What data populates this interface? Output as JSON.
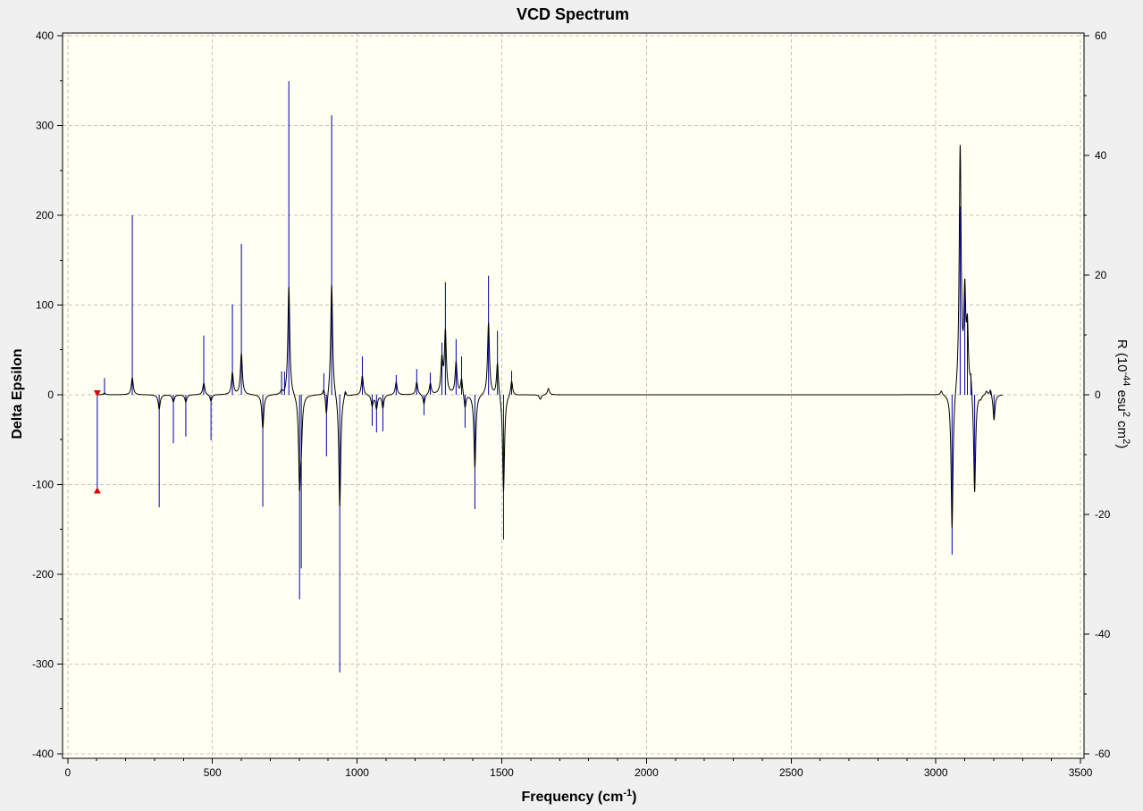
{
  "chart_data": {
    "type": "line",
    "title": "VCD Spectrum",
    "xlabel": [
      {
        "text": "Frequency (cm"
      },
      {
        "text": "-1",
        "sup": true
      },
      {
        "text": ")"
      }
    ],
    "ylabel": "Delta Epsilon",
    "ylabel_right": [
      {
        "text": "R (10"
      },
      {
        "text": "-44",
        "sup": true
      },
      {
        "text": " esu"
      },
      {
        "text": "2",
        "sup": true
      },
      {
        "text": " cm"
      },
      {
        "text": "2",
        "sup": true
      },
      {
        "text": ")"
      }
    ],
    "xlim": [
      -18,
      3512
    ],
    "ylim": [
      -405,
      403
    ],
    "ylim_right": [
      -60.75,
      60.45
    ],
    "x_ticks": [
      0,
      500,
      1000,
      1500,
      2000,
      2500,
      3000,
      3500
    ],
    "y_ticks": [
      -400,
      -300,
      -200,
      -100,
      0,
      100,
      200,
      300,
      400
    ],
    "y_right_ticks": [
      -60,
      -40,
      -20,
      0,
      20,
      40,
      60
    ],
    "grid": true,
    "colors": {
      "page_background": "#f0f0f0",
      "plot_background": "#fffff2",
      "grid": "#c4c4c4",
      "axis": "#000000"
    },
    "series": [
      {
        "axis": "left",
        "type": "line",
        "color": "#000000",
        "x_start": 100,
        "x_end": 3230,
        "peaks": [
          {
            "x": 127,
            "y": 2
          },
          {
            "x": 223,
            "y": 19
          },
          {
            "x": 316,
            "y": -16
          },
          {
            "x": 365,
            "y": -8
          },
          {
            "x": 408,
            "y": -8
          },
          {
            "x": 470,
            "y": 13
          },
          {
            "x": 495,
            "y": -7
          },
          {
            "x": 569,
            "y": 25
          },
          {
            "x": 600,
            "y": 46
          },
          {
            "x": 674,
            "y": -37
          },
          {
            "x": 739,
            "y": 6
          },
          {
            "x": 749,
            "y": 6
          },
          {
            "x": 764,
            "y": 120
          },
          {
            "x": 801,
            "y": -107
          },
          {
            "x": 807,
            "y": -70
          },
          {
            "x": 885,
            "y": 5
          },
          {
            "x": 894,
            "y": -20
          },
          {
            "x": 912,
            "y": 122
          },
          {
            "x": 940,
            "y": -124
          },
          {
            "x": 959,
            "y": 3
          },
          {
            "x": 1018,
            "y": 21
          },
          {
            "x": 1052,
            "y": -13
          },
          {
            "x": 1067,
            "y": -16
          },
          {
            "x": 1089,
            "y": -15
          },
          {
            "x": 1135,
            "y": 14
          },
          {
            "x": 1206,
            "y": 14
          },
          {
            "x": 1231,
            "y": -10
          },
          {
            "x": 1253,
            "y": 13
          },
          {
            "x": 1293,
            "y": 45
          },
          {
            "x": 1305,
            "y": 73
          },
          {
            "x": 1342,
            "y": 37
          },
          {
            "x": 1361,
            "y": 18
          },
          {
            "x": 1373,
            "y": -14
          },
          {
            "x": 1407,
            "y": -81
          },
          {
            "x": 1454,
            "y": 80
          },
          {
            "x": 1485,
            "y": 35
          },
          {
            "x": 1506,
            "y": -107
          },
          {
            "x": 1534,
            "y": 15
          },
          {
            "x": 1633,
            "y": -5
          },
          {
            "x": 1661,
            "y": 7
          },
          {
            "x": 3019,
            "y": 4
          },
          {
            "x": 3056,
            "y": -148
          },
          {
            "x": 3084,
            "y": 278
          },
          {
            "x": 3100,
            "y": 129
          },
          {
            "x": 3109,
            "y": 89
          },
          {
            "x": 3121,
            "y": 20
          },
          {
            "x": 3134,
            "y": -108
          },
          {
            "x": 3155,
            "y": -6
          },
          {
            "x": 3175,
            "y": 4
          },
          {
            "x": 3189,
            "y": 5
          },
          {
            "x": 3201,
            "y": -28
          }
        ]
      },
      {
        "axis": "right",
        "type": "stick",
        "color": "#0000aa",
        "points": [
          {
            "x": 127,
            "y": 2.8
          },
          {
            "x": 223,
            "y": 30.0
          },
          {
            "x": 316,
            "y": -18.8
          },
          {
            "x": 365,
            "y": -8.1
          },
          {
            "x": 408,
            "y": -7.0
          },
          {
            "x": 470,
            "y": 9.9
          },
          {
            "x": 495,
            "y": -7.6
          },
          {
            "x": 569,
            "y": 15.1
          },
          {
            "x": 600,
            "y": 25.2
          },
          {
            "x": 674,
            "y": -18.7
          },
          {
            "x": 739,
            "y": 3.9
          },
          {
            "x": 749,
            "y": 3.9
          },
          {
            "x": 764,
            "y": 52.4
          },
          {
            "x": 801,
            "y": -34.2
          },
          {
            "x": 807,
            "y": -29.0
          },
          {
            "x": 885,
            "y": 3.6
          },
          {
            "x": 894,
            "y": -10.3
          },
          {
            "x": 912,
            "y": 46.7
          },
          {
            "x": 940,
            "y": -46.4
          },
          {
            "x": 959,
            "y": 0.6
          },
          {
            "x": 1018,
            "y": 6.4
          },
          {
            "x": 1052,
            "y": -5.2
          },
          {
            "x": 1067,
            "y": -6.3
          },
          {
            "x": 1089,
            "y": -6.1
          },
          {
            "x": 1135,
            "y": 3.3
          },
          {
            "x": 1206,
            "y": 4.3
          },
          {
            "x": 1231,
            "y": -3.4
          },
          {
            "x": 1253,
            "y": 3.7
          },
          {
            "x": 1293,
            "y": 8.7
          },
          {
            "x": 1305,
            "y": 18.8
          },
          {
            "x": 1342,
            "y": 9.3
          },
          {
            "x": 1361,
            "y": 6.4
          },
          {
            "x": 1373,
            "y": -5.5
          },
          {
            "x": 1407,
            "y": -19.1
          },
          {
            "x": 1454,
            "y": 19.9
          },
          {
            "x": 1485,
            "y": 10.7
          },
          {
            "x": 1506,
            "y": -24.2
          },
          {
            "x": 1534,
            "y": 4.0
          },
          {
            "x": 3056,
            "y": -26.7
          },
          {
            "x": 3084,
            "y": 31.5
          },
          {
            "x": 3100,
            "y": 19.4
          },
          {
            "x": 3109,
            "y": 13.6
          },
          {
            "x": 3121,
            "y": 3.6
          },
          {
            "x": 3134,
            "y": -14.0
          },
          {
            "x": 3189,
            "y": 0.6
          },
          {
            "x": 3201,
            "y": -3.6
          }
        ]
      }
    ],
    "marker": {
      "x": 102,
      "y_top": 0,
      "y_bottom": -105,
      "line_color": "#0000aa",
      "marker_color": "#e00000"
    }
  }
}
